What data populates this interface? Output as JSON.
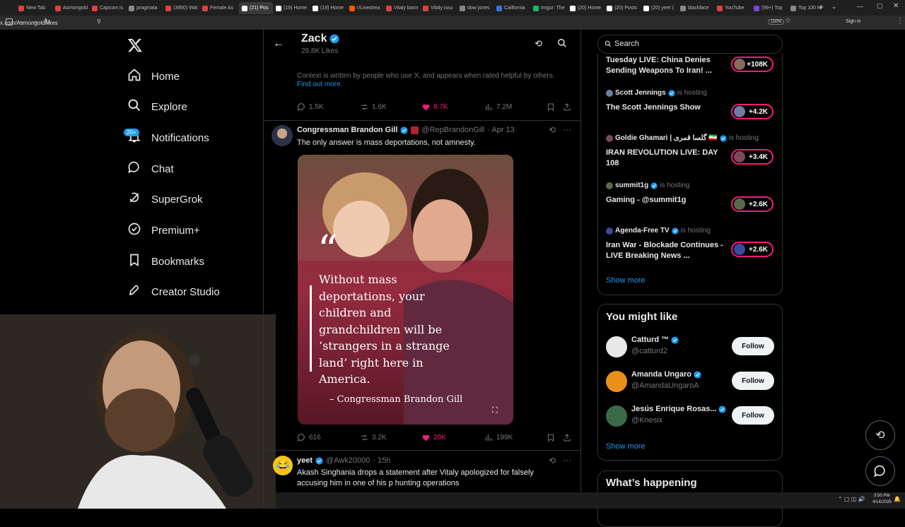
{
  "browser": {
    "tabs": [
      {
        "label": "New Tab",
        "color": "#e04040"
      },
      {
        "label": "Asmongold",
        "color": "#e04040"
      },
      {
        "label": "Capcom is",
        "color": "#e04040"
      },
      {
        "label": "pragmata",
        "color": "#888888"
      },
      {
        "label": "(3950) Wat",
        "color": "#e04040"
      },
      {
        "label": "Female As",
        "color": "#e04040"
      },
      {
        "label": "(21) Pos",
        "color": "#ffffff"
      },
      {
        "label": "(19) Home",
        "color": "#ffffff"
      },
      {
        "label": "(19) Home",
        "color": "#ffffff"
      },
      {
        "label": "r/Livestrea",
        "color": "#ff5700"
      },
      {
        "label": "Vitaly bann",
        "color": "#e04040"
      },
      {
        "label": "Vitaly issu",
        "color": "#e04040"
      },
      {
        "label": "dow jones",
        "color": "#888888"
      },
      {
        "label": "California",
        "color": "#3c6fd8"
      },
      {
        "label": "Imgur: The",
        "color": "#1bb76e"
      },
      {
        "label": "(20) Home",
        "color": "#ffffff"
      },
      {
        "label": "(20) Posts",
        "color": "#ffffff"
      },
      {
        "label": "(20) yeet (",
        "color": "#ffffff"
      },
      {
        "label": "blackface",
        "color": "#888888"
      },
      {
        "label": "YouTube",
        "color": "#e04040"
      },
      {
        "label": "(99+) Top",
        "color": "#7b45d6"
      },
      {
        "label": "Top 100 M",
        "color": "#888888"
      }
    ],
    "url": "x.com/Asmongold/likes",
    "zoom": "150%",
    "sign_in": "Sign in",
    "clock_time": "3:50 PM",
    "clock_date": "4/14/2026"
  },
  "nav": {
    "notifications_badge": "20+",
    "items": [
      {
        "label": "Home",
        "icon": "home-icon"
      },
      {
        "label": "Explore",
        "icon": "search-icon"
      },
      {
        "label": "Notifications",
        "icon": "bell-icon"
      },
      {
        "label": "Chat",
        "icon": "chat-icon"
      },
      {
        "label": "SuperGrok",
        "icon": "grok-icon"
      },
      {
        "label": "Premium+",
        "icon": "premium-icon"
      },
      {
        "label": "Bookmarks",
        "icon": "bookmark-icon"
      },
      {
        "label": "Creator Studio",
        "icon": "rocket-icon"
      }
    ]
  },
  "profile_header": {
    "name": "Zack",
    "likes": "29.8K Likes"
  },
  "context_note": {
    "text": "Context is written by people who use X, and appears when rated helpful by others.",
    "link": "Find out more."
  },
  "post1_actions": {
    "replies": "1.5K",
    "reposts": "1.6K",
    "likes": "8.7K",
    "views": "7.2M"
  },
  "post2": {
    "author": "Congressman Brandon Gill",
    "handle": "@RepBrandonGill",
    "date": "· Apr 13",
    "text": "The only answer is mass deportations, not amnesty.",
    "quote_mark": "“",
    "quote": "Without mass deportations, your children and grandchildren will be ‘strangers in a strange land’ right here in America.",
    "attribution": "– Congressman Brandon Gill",
    "replies": "616",
    "reposts": "3.2K",
    "likes": "20K",
    "views": "199K"
  },
  "post3": {
    "author": "yeet",
    "handle": "@Awk20000",
    "time": "· 15h",
    "text": "Akash Singhania drops a statement after Vitaly apologized for falsely accusing him in one of his p hunting operations"
  },
  "search": {
    "placeholder": "Search"
  },
  "spaces": {
    "items": [
      {
        "host": "",
        "title": "Tuesday LIVE: China Denies Sending Weapons To Iran! ...",
        "count": "+108K"
      },
      {
        "host": "Scott Jennings",
        "hosting": "is hosting",
        "title": "The Scott Jennings Show",
        "count": "+4.2K"
      },
      {
        "host": "Goldie Ghamari | گلسا قمری 🇮🇷",
        "hosting": "is hosting",
        "title": "IRAN REVOLUTION LIVE: DAY 108",
        "count": "+3.4K"
      },
      {
        "host": "summit1g",
        "hosting": "is hosting",
        "title": "Gaming - @summit1g",
        "count": "+2.6K"
      },
      {
        "host": "Agenda-Free TV",
        "hosting": "is hosting",
        "title": "Iran War - Blockade Continues - LIVE Breaking News ...",
        "count": "+2.6K"
      }
    ],
    "show_more": "Show more"
  },
  "who_to_follow": {
    "title": "You might like",
    "users": [
      {
        "name": "Catturd ™",
        "handle": "@catturd2",
        "button": "Follow"
      },
      {
        "name": "Amanda Ungaro",
        "handle": "@AmandaUngaroA",
        "button": "Follow"
      },
      {
        "name": "Jesús Enrique Rosas...",
        "handle": "@Knesix",
        "button": "Follow"
      }
    ],
    "show_more": "Show more"
  },
  "trending": {
    "title": "What’s happening"
  },
  "colors": {
    "accent": "#1d9bf0",
    "like": "#f91880",
    "bg": "#000000",
    "border": "#2f3336"
  }
}
